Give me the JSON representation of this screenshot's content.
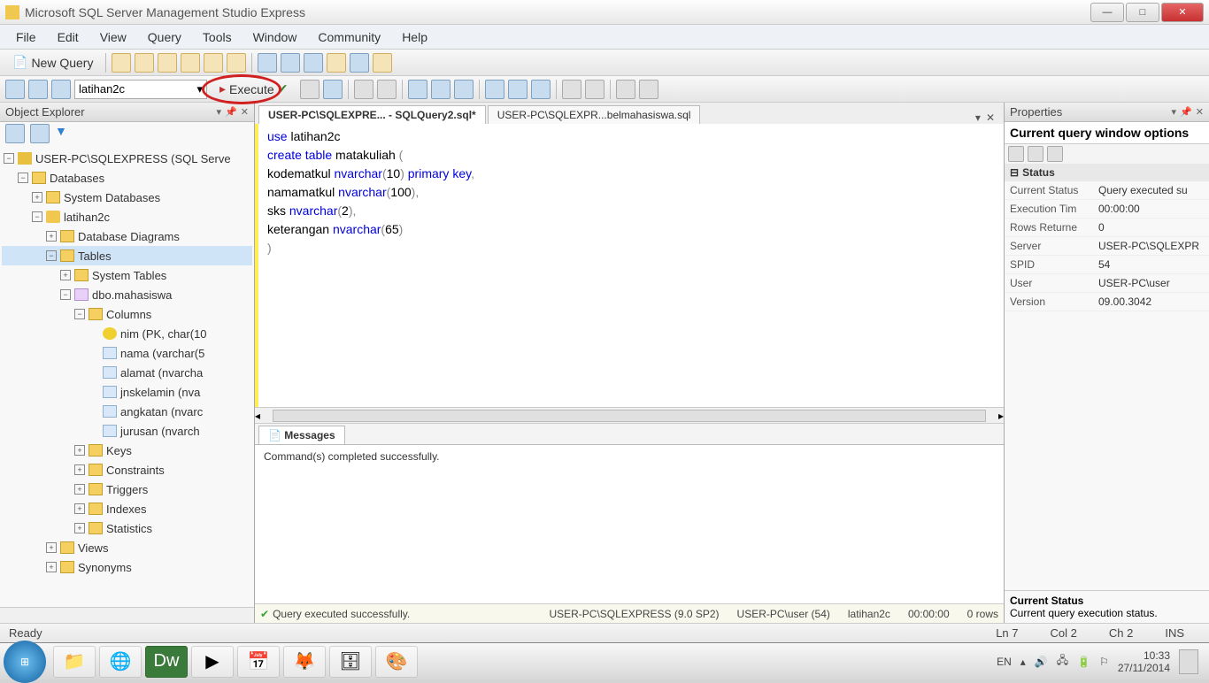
{
  "app": {
    "title": "Microsoft SQL Server Management Studio Express"
  },
  "menu": {
    "file": "File",
    "edit": "Edit",
    "view": "View",
    "query": "Query",
    "tools": "Tools",
    "window": "Window",
    "community": "Community",
    "help": "Help"
  },
  "toolbar1": {
    "newquery": "New Query"
  },
  "toolbar2": {
    "database": "latihan2c",
    "execute": "Execute"
  },
  "objectExplorer": {
    "title": "Object Explorer",
    "root": "USER-PC\\SQLEXPRESS (SQL Serve",
    "databases": "Databases",
    "systemdb": "System Databases",
    "dbname": "latihan2c",
    "dbdiagrams": "Database Diagrams",
    "tables": "Tables",
    "systables": "System Tables",
    "table_mhs": "dbo.mahasiswa",
    "columns": "Columns",
    "col1": "nim (PK, char(10",
    "col2": "nama (varchar(5",
    "col3": "alamat (nvarcha",
    "col4": "jnskelamin (nva",
    "col5": "angkatan (nvarc",
    "col6": "jurusan (nvarch",
    "keys": "Keys",
    "constraints": "Constraints",
    "triggers": "Triggers",
    "indexes": "Indexes",
    "statistics": "Statistics",
    "views": "Views",
    "synonyms": "Synonyms"
  },
  "tabs": {
    "active": "USER-PC\\SQLEXPRE... - SQLQuery2.sql*",
    "second": "USER-PC\\SQLEXPR...belmahasiswa.sql"
  },
  "code": {
    "l1a": "use",
    "l1b": " latihan2c",
    "l2a": "create",
    "l2b": " table",
    "l2c": " matakuliah ",
    "l2d": "(",
    "l3a": "    kodematkul ",
    "l3b": "nvarchar",
    "l3c": "(",
    "l3d": "10",
    "l3e": ")",
    "l3f": " primary",
    "l3g": " key",
    "l3h": ",",
    "l4a": "    namamatkul ",
    "l4b": "nvarchar",
    "l4c": "(",
    "l4d": "100",
    "l4e": "),",
    "l5a": "    sks ",
    "l5b": "nvarchar",
    "l5c": "(",
    "l5d": "2",
    "l5e": "),",
    "l6a": "    keterangan ",
    "l6b": "nvarchar",
    "l6c": "(",
    "l6d": "65",
    "l6e": ")",
    "l7": ")"
  },
  "messages": {
    "tab": "Messages",
    "text": "Command(s) completed successfully."
  },
  "queryStatus": {
    "ok": "Query executed successfully.",
    "server": "USER-PC\\SQLEXPRESS (9.0 SP2)",
    "user": "USER-PC\\user (54)",
    "db": "latihan2c",
    "time": "00:00:00",
    "rows": "0 rows"
  },
  "properties": {
    "title": "Properties",
    "heading": "Current query window options",
    "cat_status": "Status",
    "rows": {
      "curstat_n": "Current Status",
      "curstat_v": "Query executed su",
      "exectime_n": "Execution Tim",
      "exectime_v": "00:00:00",
      "rowsret_n": "Rows Returne",
      "rowsret_v": "0",
      "server_n": "Server",
      "server_v": "USER-PC\\SQLEXPR",
      "spid_n": "SPID",
      "spid_v": "54",
      "user_n": "User",
      "user_v": "USER-PC\\user",
      "version_n": "Version",
      "version_v": "09.00.3042"
    },
    "desc_title": "Current Status",
    "desc_text": "Current query execution status."
  },
  "statusbar": {
    "ready": "Ready",
    "ln": "Ln 7",
    "col": "Col 2",
    "ch": "Ch 2",
    "ins": "INS"
  },
  "tray": {
    "lang": "EN",
    "time": "10:33",
    "date": "27/11/2014"
  }
}
